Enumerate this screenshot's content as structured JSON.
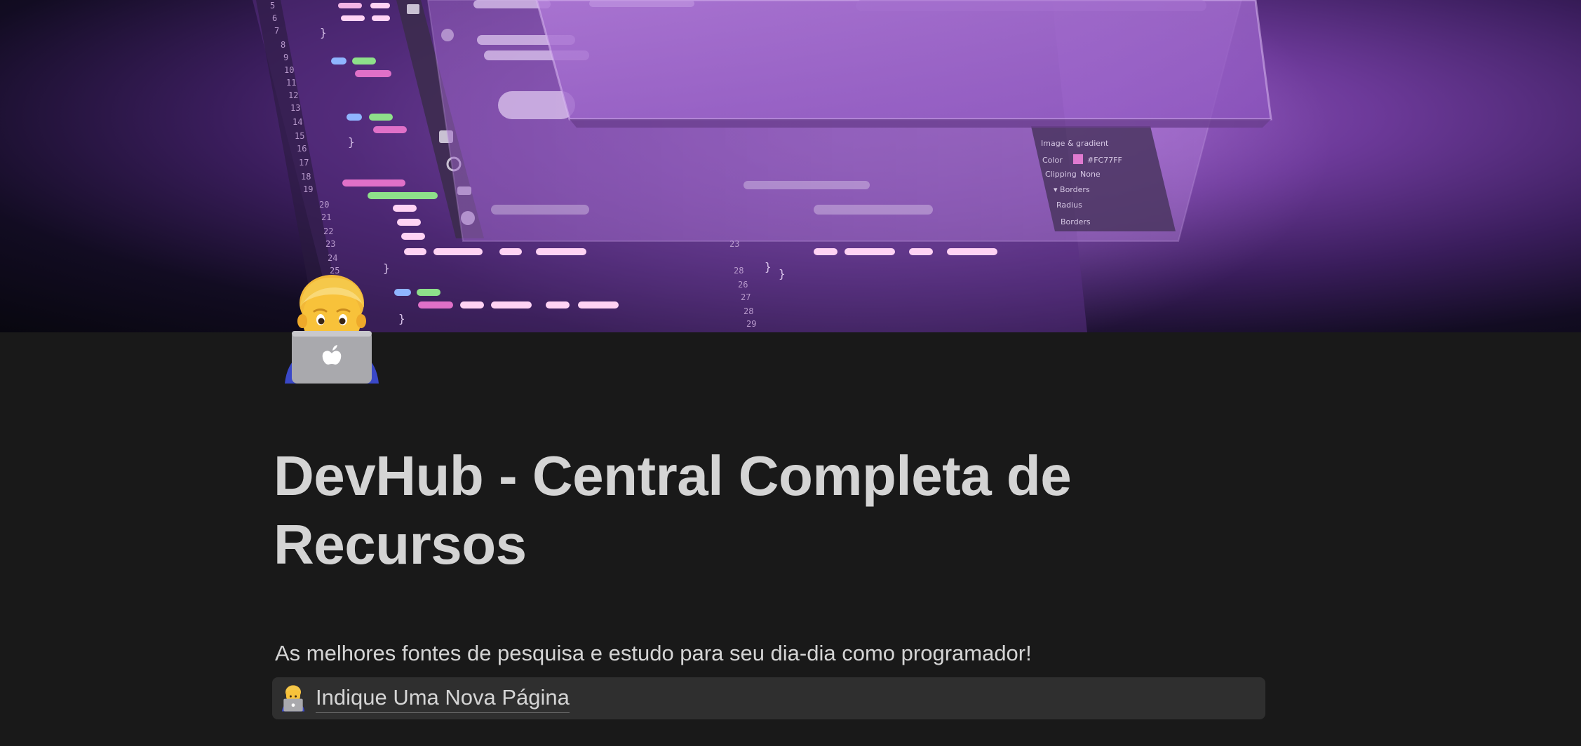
{
  "cover": {
    "description_icon": "code-editor-cover-image"
  },
  "page": {
    "icon": "technologist-laptop-icon",
    "title": "DevHub - Central Completa de Recursos",
    "subtitle": "As melhores fontes de pesquisa e estudo para seu dia-dia como programador!"
  },
  "callout": {
    "icon": "technologist-laptop-icon",
    "link_text": "Indique Uma Nova Página"
  },
  "colors": {
    "background": "#191919",
    "text": "#d4d4d4",
    "callout_bg": "#2f2f2f",
    "cover_accent": "#9a5fc7"
  }
}
